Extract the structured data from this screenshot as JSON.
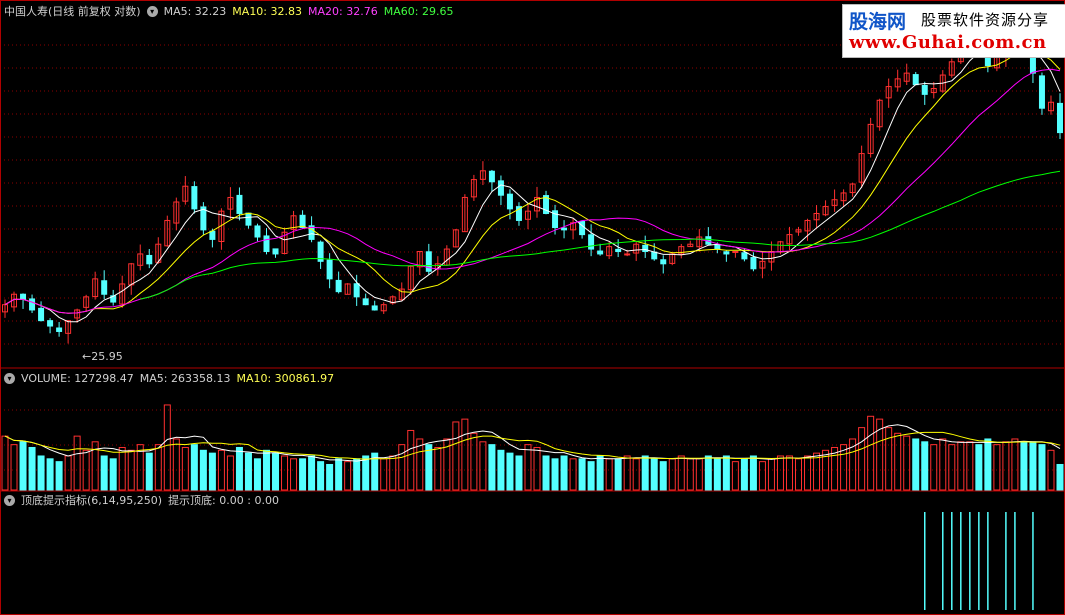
{
  "colors": {
    "background": "#000000",
    "up": "#ff3030",
    "down": "#54ffff",
    "ma5": "#ffffff",
    "ma10": "#ffff00",
    "ma20": "#ff00ff",
    "ma60": "#00ff00",
    "grid": "#8b0000",
    "border": "#b00000",
    "signal": "#54ffff"
  },
  "price_panel": {
    "title": "中国人寿(日线 前复权 对数)",
    "ma5": "MA5: 32.23",
    "ma10": "MA10: 32.83",
    "ma20": "MA20: 32.76",
    "ma60": "MA60: 29.65",
    "low_marker": "←25.95"
  },
  "volume_panel": {
    "label": "VOLUME: 127298.47",
    "ma5": "MA5: 263358.13",
    "ma10": "MA10: 300861.97"
  },
  "indicator_panel": {
    "title": "顶底提示指标(6,14,95,250)",
    "values": "提示顶底: 0.00 : 0.00"
  },
  "watermark": {
    "brand": "股海网",
    "tagline": "股票软件资源分享",
    "url": "www.Guhai.com.cn"
  },
  "chart_data": {
    "type": "candlestick",
    "y_scale": "log",
    "ylim": [
      25.0,
      40.5
    ],
    "marked_low": 25.95,
    "closes": [
      27.2,
      27.6,
      27.4,
      27.0,
      26.6,
      26.4,
      26.2,
      26.6,
      27.0,
      27.5,
      28.2,
      27.6,
      27.3,
      28.0,
      28.8,
      29.2,
      28.8,
      29.6,
      30.6,
      31.4,
      32.1,
      31.1,
      30.2,
      29.8,
      31.0,
      31.6,
      30.9,
      30.4,
      29.9,
      29.3,
      29.2,
      30.1,
      30.8,
      30.3,
      29.8,
      28.9,
      28.2,
      27.7,
      28.0,
      27.5,
      27.2,
      27.0,
      27.2,
      27.5,
      27.8,
      28.7,
      29.3,
      28.5,
      28.8,
      29.4,
      30.2,
      31.6,
      32.4,
      32.8,
      32.3,
      31.7,
      31.1,
      30.6,
      31.0,
      31.6,
      30.9,
      30.3,
      30.2,
      30.5,
      30.0,
      29.4,
      29.2,
      29.5,
      29.3,
      29.2,
      29.6,
      29.3,
      29.0,
      28.8,
      29.2,
      29.5,
      29.6,
      29.9,
      29.6,
      29.4,
      29.2,
      29.3,
      29.0,
      28.6,
      28.9,
      29.3,
      29.7,
      30.0,
      30.2,
      30.6,
      30.9,
      31.2,
      31.5,
      31.8,
      32.2,
      33.6,
      35.0,
      36.2,
      36.9,
      37.3,
      37.6,
      37.0,
      36.5,
      36.8,
      37.5,
      38.2,
      39.2,
      39.6,
      39.0,
      38.0,
      38.5,
      39.4,
      39.8,
      39.1,
      37.6,
      35.8,
      36.1,
      34.6
    ],
    "ma60_last": 29.65,
    "volume": {
      "ylim": [
        0,
        650000
      ],
      "bars_scaled": [
        0.95,
        0.8,
        0.85,
        0.75,
        0.6,
        0.55,
        0.5,
        0.6,
        0.95,
        0.7,
        0.85,
        0.6,
        0.55,
        0.75,
        0.7,
        0.8,
        0.65,
        0.8,
        1.5,
        0.9,
        0.75,
        0.8,
        0.7,
        0.65,
        0.7,
        0.6,
        0.75,
        0.65,
        0.55,
        0.7,
        0.65,
        0.6,
        0.55,
        0.55,
        0.6,
        0.5,
        0.45,
        0.55,
        0.5,
        0.55,
        0.6,
        0.65,
        0.55,
        0.6,
        0.8,
        1.05,
        0.9,
        0.8,
        0.75,
        0.9,
        1.2,
        1.25,
        1.0,
        0.85,
        0.8,
        0.7,
        0.65,
        0.6,
        0.8,
        0.75,
        0.6,
        0.55,
        0.6,
        0.55,
        0.55,
        0.5,
        0.6,
        0.55,
        0.55,
        0.6,
        0.55,
        0.6,
        0.55,
        0.5,
        0.55,
        0.6,
        0.55,
        0.55,
        0.6,
        0.55,
        0.6,
        0.5,
        0.55,
        0.6,
        0.5,
        0.55,
        0.6,
        0.6,
        0.55,
        0.6,
        0.65,
        0.7,
        0.75,
        0.8,
        0.9,
        1.1,
        1.3,
        1.25,
        1.1,
        1.0,
        0.95,
        0.9,
        0.85,
        0.8,
        0.9,
        0.8,
        0.85,
        0.85,
        0.8,
        0.9,
        0.8,
        0.85,
        0.9,
        0.85,
        0.85,
        0.8,
        0.7,
        0.45
      ],
      "last": 127298.47,
      "ma5_last": 263358.13,
      "ma10_last": 300861.97
    },
    "signals": [
      0.0,
      0.0
    ],
    "signal_bar_indices": [
      102,
      104,
      105,
      106,
      107,
      108,
      109,
      111,
      112,
      114
    ]
  }
}
